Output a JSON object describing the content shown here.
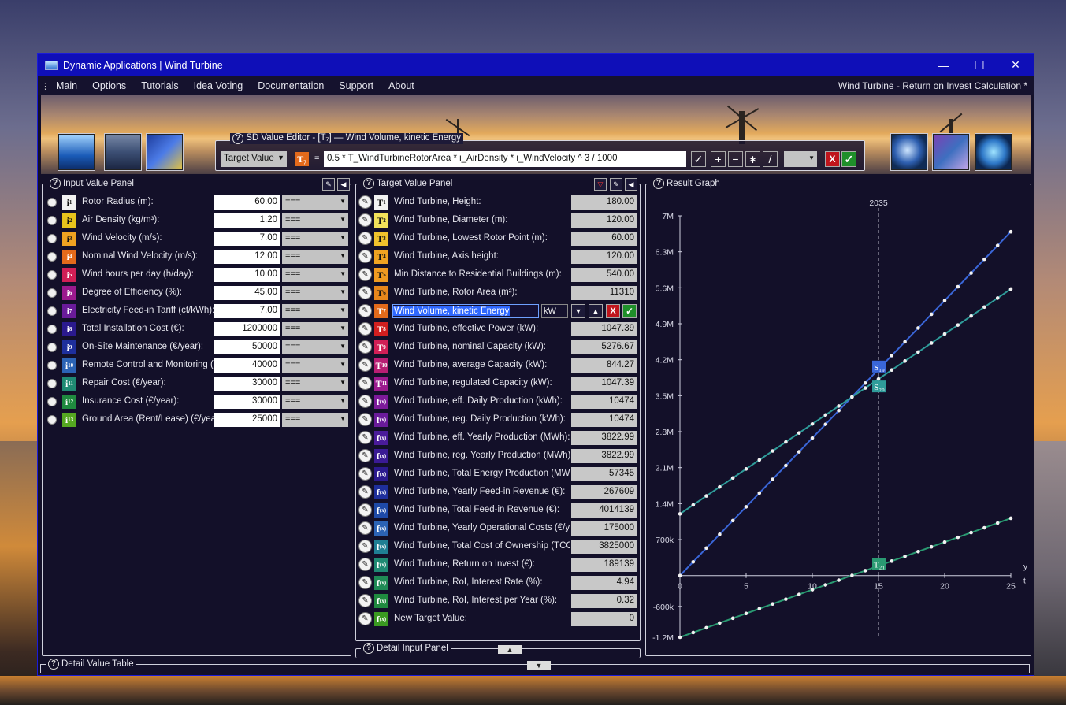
{
  "window": {
    "title": "Dynamic Applications | Wind Turbine",
    "minimize": "—",
    "maximize": "☐",
    "close": "✕"
  },
  "menu": {
    "items": [
      "Main",
      "Options",
      "Tutorials",
      "Idea Voting",
      "Documentation",
      "Support",
      "About"
    ],
    "document_title": "Wind Turbine - Return on Invest Calculation *"
  },
  "sd_editor": {
    "title": "SD Value Editor - [T₇]  —  Wind Volume, kinetic Energy",
    "mode": "Target Value",
    "tag": "T₇",
    "equals": "=",
    "formula": "0.5 * T_WindTurbineRotorArea * i_AirDensity * i_WindVelocity ^ 3 / 1000",
    "buttons": [
      "✓",
      "+",
      "−",
      "∗",
      "/"
    ],
    "cancel": "X",
    "ok": "✓"
  },
  "input_panel": {
    "title": "Input Value Panel",
    "rows": [
      {
        "tag": "i",
        "sub": "1",
        "label": "Rotor Radius (m):",
        "value": "60.00",
        "op": "===",
        "color": "#f2f2f2",
        "fg": "#111"
      },
      {
        "tag": "i",
        "sub": "2",
        "label": "Air Density (kg/m³):",
        "value": "1.20",
        "op": "===",
        "color": "#e8c41c",
        "fg": "#111"
      },
      {
        "tag": "i",
        "sub": "3",
        "label": "Wind Velocity (m/s):",
        "value": "7.00",
        "op": "===",
        "color": "#f0a321",
        "fg": "#111"
      },
      {
        "tag": "i",
        "sub": "4",
        "label": "Nominal Wind Velocity (m/s):",
        "value": "12.00",
        "op": "===",
        "color": "#e36a1b",
        "fg": "#fff"
      },
      {
        "tag": "i",
        "sub": "5",
        "label": "Wind hours per day (h/day):",
        "value": "10.00",
        "op": "===",
        "color": "#d11f56",
        "fg": "#fff"
      },
      {
        "tag": "i",
        "sub": "6",
        "label": "Degree of Efficiency (%):",
        "value": "45.00",
        "op": "===",
        "color": "#9b1a8e",
        "fg": "#fff"
      },
      {
        "tag": "i",
        "sub": "7",
        "label": "Electricity Feed-in Tariff (ct/kWh):",
        "value": "7.00",
        "op": "===",
        "color": "#6a1b9a",
        "fg": "#fff"
      },
      {
        "tag": "i",
        "sub": "8",
        "label": "Total Installation Cost (€):",
        "value": "1200000",
        "op": "===",
        "color": "#2b1a8e",
        "fg": "#fff"
      },
      {
        "tag": "i",
        "sub": "9",
        "label": "On-Site Maintenance (€/year):",
        "value": "50000",
        "op": "===",
        "color": "#1e2f9c",
        "fg": "#fff"
      },
      {
        "tag": "i",
        "sub": "10",
        "label": "Remote Control and Monitoring (€/year):",
        "value": "40000",
        "op": "===",
        "color": "#2b63b5",
        "fg": "#fff"
      },
      {
        "tag": "i",
        "sub": "11",
        "label": "Repair Cost (€/year):",
        "value": "30000",
        "op": "===",
        "color": "#1f8a73",
        "fg": "#fff"
      },
      {
        "tag": "i",
        "sub": "12",
        "label": "Insurance Cost (€/year):",
        "value": "30000",
        "op": "===",
        "color": "#1f8a3f",
        "fg": "#fff"
      },
      {
        "tag": "i",
        "sub": "13",
        "label": "Ground Area (Rent/Lease) (€/year):",
        "value": "25000",
        "op": "===",
        "color": "#55a821",
        "fg": "#fff"
      }
    ]
  },
  "target_panel": {
    "title": "Target Value Panel",
    "editing": {
      "name": "Wind Volume, kinetic Energy",
      "unit": "kW",
      "cancel": "X",
      "ok": "✓"
    },
    "rows": [
      {
        "tag": "T",
        "sub": "1",
        "label": "Wind Turbine, Height:",
        "value": "180.00",
        "color": "#f2f2f2",
        "fg": "#111"
      },
      {
        "tag": "T",
        "sub": "2",
        "label": "Wind Turbine, Diameter (m):",
        "value": "120.00",
        "color": "#f2e25a",
        "fg": "#111"
      },
      {
        "tag": "T",
        "sub": "3",
        "label": "Wind Turbine, Lowest Rotor Point (m):",
        "value": "60.00",
        "color": "#f0c22c",
        "fg": "#111"
      },
      {
        "tag": "T",
        "sub": "4",
        "label": "Wind Turbine, Axis height:",
        "value": "120.00",
        "color": "#f0a321",
        "fg": "#111"
      },
      {
        "tag": "T",
        "sub": "5",
        "label": "Min Distance to Residential Buildings (m):",
        "value": "540.00",
        "color": "#f09a21",
        "fg": "#111"
      },
      {
        "tag": "T",
        "sub": "6",
        "label": "Wind Turbine, Rotor Area (m²):",
        "value": "11310",
        "color": "#e8861b",
        "fg": "#111"
      },
      {
        "tag": "T",
        "sub": "7",
        "label": "",
        "value": "",
        "color": "#e36a1b",
        "fg": "#fff",
        "edit": true
      },
      {
        "tag": "T",
        "sub": "8",
        "label": "Wind Turbine, effective Power (kW):",
        "value": "1047.39",
        "color": "#d11f1f",
        "fg": "#fff"
      },
      {
        "tag": "T",
        "sub": "9",
        "label": "Wind Turbine, nominal Capacity (kW):",
        "value": "5276.67",
        "color": "#d11f56",
        "fg": "#fff"
      },
      {
        "tag": "T",
        "sub": "10",
        "label": "Wind Turbine, average Capacity (kW):",
        "value": "844.27",
        "color": "#b81e73",
        "fg": "#fff"
      },
      {
        "tag": "T",
        "sub": "11",
        "label": "Wind Turbine, regulated Capacity (kW):",
        "value": "1047.39",
        "color": "#9b1a8e",
        "fg": "#fff"
      },
      {
        "tag": "f",
        "sub": "(x)",
        "label": "Wind Turbine, eff. Daily Production (kWh):",
        "value": "10474",
        "color": "#7d1a9a",
        "fg": "#fff"
      },
      {
        "tag": "f",
        "sub": "(x)",
        "label": "Wind Turbine, reg. Daily Production (kWh):",
        "value": "10474",
        "color": "#6a1b9a",
        "fg": "#fff"
      },
      {
        "tag": "f",
        "sub": "(x)",
        "label": "Wind Turbine, eff. Yearly Production (MWh):",
        "value": "3822.99",
        "color": "#4a1b9a",
        "fg": "#fff"
      },
      {
        "tag": "f",
        "sub": "(x)",
        "label": "Wind Turbine, reg. Yearly Production (MWh):",
        "value": "3822.99",
        "color": "#3a1a94",
        "fg": "#fff"
      },
      {
        "tag": "f",
        "sub": "(x)",
        "label": "Wind Turbine, Total Energy Production (MWh):",
        "value": "57345",
        "color": "#2b1a8e",
        "fg": "#fff"
      },
      {
        "tag": "f",
        "sub": "(x)",
        "label": "Wind Turbine, Yearly Feed-in Revenue (€):",
        "value": "267609",
        "color": "#1e2f9c",
        "fg": "#fff"
      },
      {
        "tag": "f",
        "sub": "(x)",
        "label": "Wind Turbine, Total Feed-in Revenue (€):",
        "value": "4014139",
        "color": "#1e4aa8",
        "fg": "#fff"
      },
      {
        "tag": "f",
        "sub": "(x)",
        "label": "Wind Turbine, Yearly Operational Costs (€/year):",
        "value": "175000",
        "color": "#2b63b5",
        "fg": "#fff"
      },
      {
        "tag": "f",
        "sub": "(x)",
        "label": "Wind Turbine, Total Cost of Ownership (TCO) (€):",
        "value": "3825000",
        "color": "#1f7f94",
        "fg": "#fff"
      },
      {
        "tag": "f",
        "sub": "(x)",
        "label": "Wind Turbine, Return on Invest (€):",
        "value": "189139",
        "color": "#1f8a73",
        "fg": "#fff"
      },
      {
        "tag": "f",
        "sub": "(x)",
        "label": "Wind Turbine, RoI, Interest Rate (%):",
        "value": "4.94",
        "color": "#1f8a55",
        "fg": "#fff"
      },
      {
        "tag": "f",
        "sub": "(x)",
        "label": "Wind Turbine, RoI, Interest per Year (%):",
        "value": "0.32",
        "color": "#1f8a3f",
        "fg": "#fff"
      },
      {
        "tag": "f",
        "sub": "(x)",
        "label": "New Target Value:",
        "value": "0",
        "color": "#3a9a21",
        "fg": "#fff"
      }
    ]
  },
  "graph_panel": {
    "title": "Result Graph"
  },
  "detail_input_panel": {
    "title": "Detail Input Panel",
    "toggle": "▲"
  },
  "detail_table": {
    "title": "Detail Value Table",
    "toggle": "▼"
  },
  "chart_data": {
    "type": "line",
    "marker_label": "2035",
    "marker_x": 15,
    "xlabel": "t",
    "ylabel": "y",
    "xlim": [
      0,
      25
    ],
    "ylim": [
      -1200000,
      7000000
    ],
    "x_ticks": [
      "0",
      "5",
      "10",
      "15",
      "20",
      "25"
    ],
    "y_ticks": [
      {
        "v": 7000000,
        "t": "7M"
      },
      {
        "v": 6300000,
        "t": "6.3M"
      },
      {
        "v": 5600000,
        "t": "5.6M"
      },
      {
        "v": 4900000,
        "t": "4.9M"
      },
      {
        "v": 4200000,
        "t": "4.2M"
      },
      {
        "v": 3500000,
        "t": "3.5M"
      },
      {
        "v": 2800000,
        "t": "2.8M"
      },
      {
        "v": 2100000,
        "t": "2.1M"
      },
      {
        "v": 1400000,
        "t": "1.4M"
      },
      {
        "v": 700000,
        "t": "700k"
      },
      {
        "v": -600000,
        "t": "-600k"
      },
      {
        "v": -1200000,
        "t": "-1.2M"
      }
    ],
    "series": [
      {
        "label": "S₁₉",
        "color": "#3a66d8",
        "start": 0,
        "slope": 267609
      },
      {
        "label": "S₂₀",
        "color": "#2f9c9a",
        "start": 1200000,
        "slope": 175000
      },
      {
        "label": "T₂₁",
        "color": "#2a9a72",
        "start": -1200000,
        "slope": 92609
      }
    ],
    "x_points": [
      0,
      1,
      2,
      3,
      4,
      5,
      6,
      7,
      8,
      9,
      10,
      11,
      12,
      13,
      14,
      15,
      16,
      17,
      18,
      19,
      20,
      21,
      22,
      23,
      24,
      25
    ]
  }
}
